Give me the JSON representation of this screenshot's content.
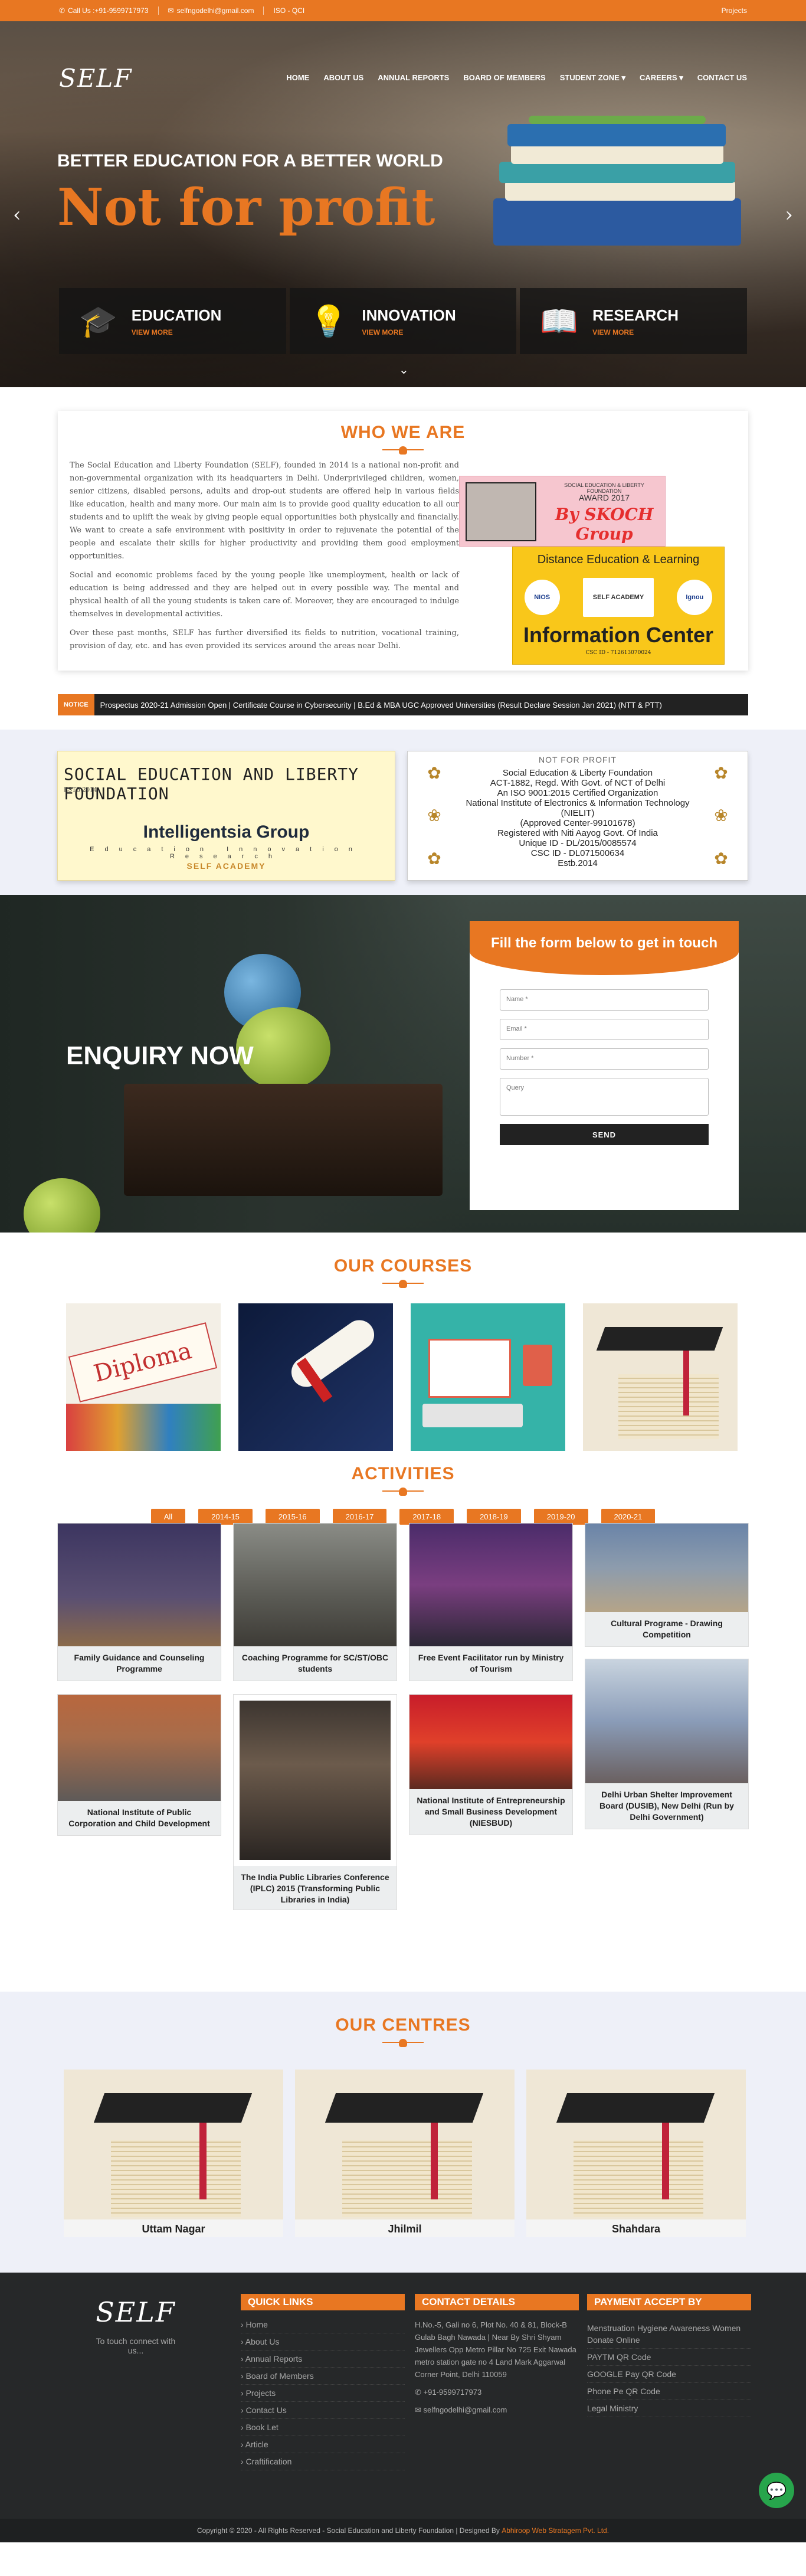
{
  "topbar": {
    "phone": "Call Us :+91-9599717973",
    "email": "selfngodelhi@gmail.com",
    "iso": "ISO - QCI",
    "projects": "Projects"
  },
  "nav": {
    "logo": "SELF",
    "items": [
      "HOME",
      "ABOUT US",
      "ANNUAL REPORTS",
      "BOARD OF MEMBERS",
      "STUDENT ZONE",
      "CAREERS",
      "CONTACT US"
    ]
  },
  "hero": {
    "subtitle": "BETTER EDUCATION FOR A BETTER WORLD",
    "title": "Not for profit",
    "cards": [
      {
        "title": "EDUCATION",
        "link": "VIEW MORE"
      },
      {
        "title": "INNOVATION",
        "link": "VIEW MORE"
      },
      {
        "title": "RESEARCH",
        "link": "VIEW MORE"
      }
    ]
  },
  "who": {
    "title": "WHO WE ARE",
    "p1": "The Social Education and Liberty Foundation (SELF), founded in 2014 is a national non-profit and non-governmental organization with its headquarters in Delhi. Underprivileged children, women, senior citizens, disabled persons, adults and drop-out students are offered help in various fields like education, health and many more. Our main aim is to provide good quality education to all our students and to uplift the weak by giving people equal opportunities both physically and financially. We want to create a safe environment with positivity in order to rejuvenate the potential of the people and escalate their skills for higher productivity and providing them good employment opportunities.",
    "p2": "Social and economic problems faced by the young people like unemployment, health or lack of education is being addressed and they are helped out in every possible way. The mental and physical health of all the young students is taken care of. Moreover, they are encouraged to indulge themselves in developmental activities.",
    "p3": "Over these past months, SELF has further diversified its fields to nutrition, vocational training, provision of day, etc. and has even provided its services around the areas near Delhi.",
    "award": {
      "t1": "SOCIAL EDUCATION & LIBERTY FOUNDATION",
      "t2": "AWARD 2017",
      "t3": "By SKOCH Group"
    },
    "yellow": {
      "t1": "Distance Education & Learning",
      "t2": "Information Center",
      "t3": "CSC ID - 712613070024",
      "logos": [
        "NIOS",
        "SELF ACADEMY",
        "Ignou"
      ]
    }
  },
  "notice": {
    "tag": "NOTICE",
    "text": "Prospectus 2020-21 Admission Open  |  Certificate Course in Cybersecurity  |  B.Ed & MBA UGC Approved Universities (Result Declare Session Jan 2021) (NTT & PTT)"
  },
  "partner1": {
    "a": "SOCIAL EDUCATION AND LIBERTY FOUNDATION",
    "b": "ESTB 2014",
    "c": "Intelligentsia Group",
    "d": "Education Innovation Research",
    "e": "SELF ACADEMY"
  },
  "partner2": {
    "hd": "NOT FOR PROFIT",
    "lines": [
      "Social Education & Liberty Foundation",
      "ACT-1882, Regd. With Govt. of NCT of Delhi",
      "An ISO 9001:2015 Certified Organization",
      "National Institute of Electronics & Information Technology (NIELIT)",
      "(Approved Center-99101678)",
      "Registered with Niti Aayog Govt. Of India",
      "Unique ID - DL/2015/0085574",
      "CSC ID - DL071500634",
      "Estb.2014"
    ]
  },
  "enquiry": {
    "title": "ENQUIRY NOW",
    "form_title": "Fill the form below to get in touch",
    "name": "Name *",
    "email": "Email *",
    "number": "Number *",
    "query": "Query",
    "send": "SEND"
  },
  "courses": {
    "title": "OUR COURSES"
  },
  "activities": {
    "title": "ACTIVITIES",
    "tabs": [
      "All",
      "2014-15",
      "2015-16",
      "2016-17",
      "2017-18",
      "2018-19",
      "2019-20",
      "2020-21"
    ],
    "items": [
      "Family Guidance and Counseling Programme",
      "Coaching Programme for SC/ST/OBC students",
      "Free Event Facilitator run by Ministry of Tourism",
      "Cultural Programe - Drawing Competition",
      "National Institute of Public Corporation and Child Development",
      "The India Public Libraries Conference (IPLC) 2015 (Transforming Public Libraries in India)",
      "National Institute of Entrepreneurship and Small Business Development (NIESBUD)",
      "Delhi Urban Shelter Improvement Board (DUSIB), New Delhi (Run by Delhi Government)"
    ]
  },
  "centres": {
    "title": "OUR CENTRES",
    "items": [
      "Uttam Nagar",
      "Jhilmil",
      "Shahdara"
    ]
  },
  "footer": {
    "tagline": "To touch connect with us...",
    "ql_title": "QUICK LINKS",
    "links": [
      "Home",
      "About Us",
      "Annual Reports",
      "Board of Members",
      "Projects",
      "Contact Us",
      "Book Let",
      "Article",
      "Craftification"
    ],
    "cd_title": "CONTACT DETAILS",
    "address": "H.No.-5, Gali no 6, Plot No. 40 & 81, Block-B Gulab Bagh Nawada | Near By Shri Shyam Jewellers Opp Metro Pillar No 725 Exit Nawada metro station gate no 4 Land Mark Aggarwal Corner Point, Delhi 110059",
    "phone": "+91-9599717973",
    "email": "selfngodelhi@gmail.com",
    "pa_title": "PAYMENT ACCEPT BY",
    "payments": [
      "Menstruation Hygiene Awareness Women Donate Online",
      "PAYTM QR Code",
      "GOOGLE Pay QR Code",
      "Phone Pe QR Code",
      "Legal Ministry"
    ],
    "copyright": "Copyright © 2020 - All Rights Reserved - Social Education and Liberty Foundation  |  Designed By ",
    "designer": "Abhiroop Web Stratagem Pvt. Ltd."
  },
  "colors": {
    "accent": "#e87722",
    "dark": "#262829"
  }
}
